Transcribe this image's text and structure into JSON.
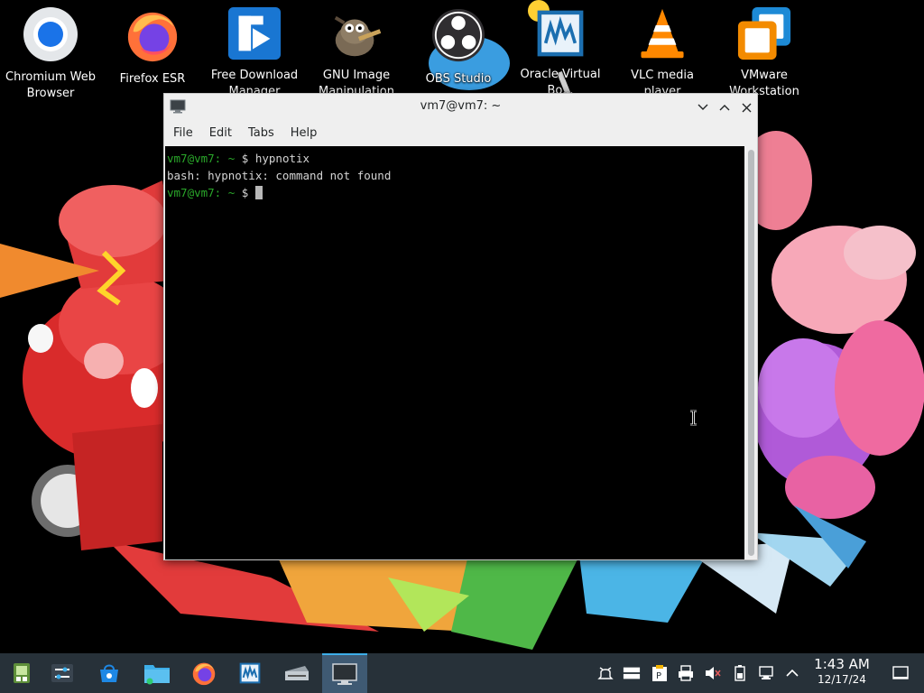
{
  "desktop": {
    "icons": [
      {
        "label": "Chromium Web Browser",
        "icon": "chromium-icon"
      },
      {
        "label": "Firefox ESR",
        "icon": "firefox-icon"
      },
      {
        "label": "Free Download Manager",
        "icon": "free-download-manager-icon"
      },
      {
        "label": "GNU Image Manipulation",
        "icon": "gimp-icon"
      },
      {
        "label": "OBS Studio",
        "icon": "obs-icon"
      },
      {
        "label": "Oracle Virtual Bo...",
        "icon": "virtualbox-icon"
      },
      {
        "label": "VLC media player",
        "icon": "vlc-icon"
      },
      {
        "label": "VMware Workstation",
        "icon": "vmware-icon"
      }
    ]
  },
  "terminal": {
    "title": "vm7@vm7: ~",
    "menu": [
      "File",
      "Edit",
      "Tabs",
      "Help"
    ],
    "lines": [
      {
        "prompt": "vm7@vm7:",
        "dir": " ~",
        "sep": " $ ",
        "text": "hypnotix"
      },
      {
        "prompt": "",
        "dir": "",
        "sep": "",
        "text": "bash: hypnotix: command not found"
      },
      {
        "prompt": "vm7@vm7:",
        "dir": " ~",
        "sep": " $ ",
        "text": ""
      }
    ]
  },
  "taskbar": {
    "items": [
      "application-launcher-icon",
      "settings-icon",
      "store-icon",
      "file-manager-icon",
      "firefox-icon",
      "virtualbox-icon",
      "scanner-icon",
      "terminal-icon"
    ],
    "active": "terminal-icon",
    "tray": [
      "notifications-icon",
      "drive-icon",
      "clipboard-icon",
      "printer-icon",
      "volume-muted-icon",
      "battery-icon",
      "network-icon",
      "expand-tray-icon"
    ],
    "clock": {
      "time": "1:43 AM",
      "date": "12/17/24"
    },
    "show_desktop": "show-desktop-icon"
  },
  "colors": {
    "prompt": "#2aa82a",
    "taskbar": "#273139",
    "accent": "#3daee9"
  }
}
